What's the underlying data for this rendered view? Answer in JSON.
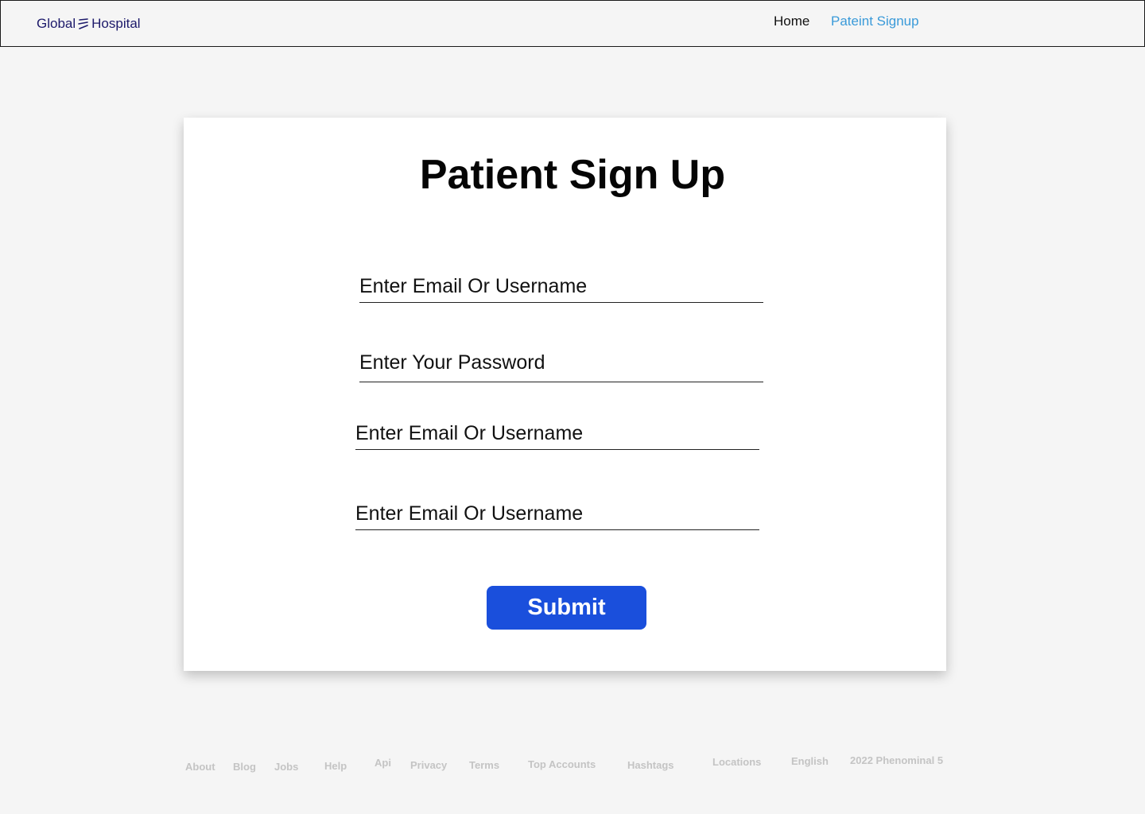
{
  "header": {
    "logo": {
      "text_left": "Global",
      "text_right": "Hospital",
      "icon": "logo-mark-icon",
      "color": "#1d1a6b"
    },
    "nav": [
      {
        "label": "Home",
        "active": false
      },
      {
        "label": "Pateint Signup",
        "active": true
      }
    ],
    "active_color": "#3a9ad9"
  },
  "form": {
    "title": "Patient Sign Up",
    "fields": [
      {
        "value": "",
        "placeholder": "Enter Email Or Username"
      },
      {
        "value": "",
        "placeholder": "Enter Your Password"
      },
      {
        "value": "",
        "placeholder": "Enter Email Or Username"
      },
      {
        "value": "",
        "placeholder": "Enter Email Or Username"
      }
    ],
    "submit_label": "Submit",
    "submit_color": "#1a4fdc"
  },
  "footer": {
    "links": [
      "About",
      "Blog",
      "Jobs",
      "Help",
      "Api",
      "Privacy",
      "Terms",
      "Top Accounts",
      "Hashtags",
      "Locations",
      "English",
      "2022 Phenominal 5"
    ]
  }
}
